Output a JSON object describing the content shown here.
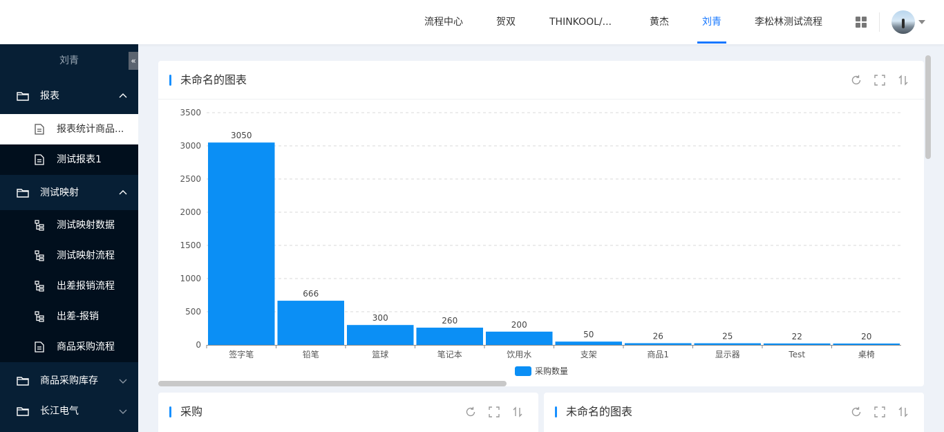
{
  "topnav": {
    "tabs": [
      {
        "label": "流程中心",
        "active": false
      },
      {
        "label": "贺双",
        "active": false
      },
      {
        "label": "THINKOOL/...",
        "active": false
      },
      {
        "label": "黄杰",
        "active": false
      },
      {
        "label": "刘青",
        "active": true
      },
      {
        "label": "李松林测试流程",
        "active": false
      }
    ],
    "apps_icon": "grid-icon",
    "avatar_icon": "user-avatar"
  },
  "sidebar": {
    "user": "刘青",
    "collapse_symbol": "«",
    "groups": [
      {
        "label": "报表",
        "expanded": true,
        "items": [
          {
            "label": "报表统计商品...",
            "icon": "document-icon",
            "active": true
          },
          {
            "label": "测试报表1",
            "icon": "document-icon",
            "active": false
          }
        ]
      },
      {
        "label": "测试映射",
        "expanded": true,
        "items": [
          {
            "label": "测试映射数据",
            "icon": "tree-icon"
          },
          {
            "label": "测试映射流程",
            "icon": "tree-icon"
          },
          {
            "label": "出差报销流程",
            "icon": "tree-icon"
          },
          {
            "label": "出差-报销",
            "icon": "tree-icon"
          },
          {
            "label": "商品采购流程",
            "icon": "document-icon"
          }
        ]
      },
      {
        "label": "商品采购库存",
        "expanded": false,
        "items": []
      },
      {
        "label": "长江电气",
        "expanded": false,
        "items": []
      }
    ]
  },
  "cards": {
    "main_title": "未命名的图表",
    "bottom_left_title": "采购",
    "bottom_right_title": "未命名的图表"
  },
  "colors": {
    "accent": "#1677ff",
    "bar": "#0b8ff5",
    "sidebar": "#071f35"
  },
  "chart_data": {
    "type": "bar",
    "categories": [
      "签字笔",
      "铅笔",
      "篮球",
      "笔记本",
      "饮用水",
      "支架",
      "商品1",
      "显示器",
      "Test",
      "桌椅"
    ],
    "series": [
      {
        "name": "采购数量",
        "values": [
          3050,
          666,
          300,
          260,
          200,
          50,
          26,
          25,
          22,
          20
        ]
      }
    ],
    "ylim": [
      0,
      3500
    ],
    "yticks": [
      0,
      500,
      1000,
      1500,
      2000,
      2500,
      3000,
      3500
    ],
    "grid": true,
    "legend": "bottom-center"
  }
}
